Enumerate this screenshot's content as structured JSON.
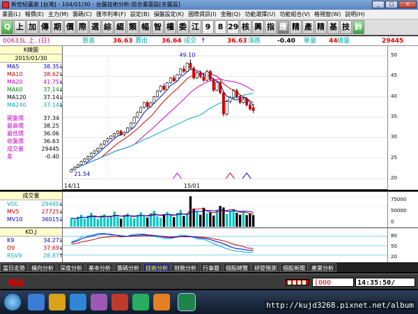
{
  "window": {
    "title": "新世紀贏家 [台灣] - 104/01/30 - 台盤技術分析:綜合畫面設[名盤設]",
    "buttons": [
      "_",
      "□",
      "X"
    ]
  },
  "menu": [
    "畫面(L)",
    "報價(E)",
    "主力(M)",
    "籌碼(C)",
    "匯市利率(F)",
    "設定(B)",
    "損盤設定(K)",
    "國際資訊(I)",
    "金融(Q)",
    "功能選擇(U)",
    "功能組合(V)",
    "格視窗(W)",
    "說明(H)"
  ],
  "toolbar": {
    "buttons": [
      "Q",
      "上",
      "加",
      "傳",
      "期",
      "價",
      "際",
      "選",
      "綜",
      "綴",
      "類",
      "幅",
      "智",
      "權",
      "委",
      "江",
      "9",
      "8",
      "29",
      "核",
      "興",
      "指",
      "應",
      "精",
      "產",
      "精",
      "基",
      "技",
      "鈴"
    ]
  },
  "quote": {
    "symbol": "00633L 上..(日)",
    "buy_label": "買進",
    "buy_value": "36.63",
    "sell_label": "賣出",
    "sell_value": "36.64",
    "deal_label": "成交",
    "deal_arrow": "↑",
    "deal_value": "36.63",
    "change_label": "漲跌",
    "change_value": "-0.40",
    "unit_label": "單量",
    "unit_value": "44",
    "total_label": "總量",
    "total_value": "29445"
  },
  "left_panel": {
    "title": "K線圖",
    "date": "2015/01/30",
    "ma": [
      {
        "label": "MA5",
        "value": "38.35",
        "arrow": "↓",
        "color": "#0000cc"
      },
      {
        "label": "MA10",
        "value": "38.62",
        "arrow": "↓",
        "color": "#cc0000"
      },
      {
        "label": "MA20",
        "value": "41.75",
        "arrow": "↓",
        "color": "#cc00cc"
      },
      {
        "label": "MA60",
        "value": "37.14",
        "arrow": "↓",
        "color": "#008800"
      },
      {
        "label": "MA120",
        "value": "37.14",
        "arrow": "↓",
        "color": "#000000"
      },
      {
        "label": "MA240",
        "value": "37.14",
        "arrow": "↓",
        "color": "#00aacc"
      }
    ],
    "prices": [
      {
        "label": "開盤價",
        "value": "37.34"
      },
      {
        "label": "最高價",
        "value": "38.25"
      },
      {
        "label": "最低價",
        "value": "36.06"
      },
      {
        "label": "收盤價",
        "value": "36.63"
      },
      {
        "label": "成交量",
        "value": "29445"
      },
      {
        "label": "差",
        "value": "-0.40"
      }
    ]
  },
  "volume_panel": {
    "title": "成交量",
    "rows": [
      {
        "label": "VOL",
        "value": "29445",
        "arrow": "↓",
        "color": "#00aacc"
      },
      {
        "label": "MV5",
        "value": "27725",
        "arrow": "↓",
        "color": "#cc0000"
      },
      {
        "label": "MV10",
        "value": "36015",
        "arrow": "↓",
        "color": "#0000cc"
      }
    ],
    "axis": [
      "75000",
      "50000",
      "0"
    ]
  },
  "kd_panel": {
    "title": "KD,J",
    "rows": [
      {
        "label": "K9",
        "value": "34.27",
        "arrow": "↓",
        "color": "#0000cc"
      },
      {
        "label": "D9",
        "value": "37.69",
        "arrow": "↓",
        "color": "#cc0000"
      },
      {
        "label": "RSV9",
        "value": "28.87",
        "arrow": "↑",
        "color": "#00aacc"
      }
    ],
    "axis": [
      "80",
      "50",
      "20"
    ]
  },
  "main_chart": {
    "high_label": "49.10",
    "low_label": "21.54",
    "x_labels": [
      "14/11",
      "15/01"
    ],
    "y_axis": [
      "50",
      "45",
      "40",
      "35",
      "30",
      "25",
      "20"
    ]
  },
  "tabs": [
    "當日走勢",
    "橫向分析",
    "深度分析",
    "基本分析",
    "籌碼分析",
    "技術分析",
    "財務分析",
    "行事曆",
    "個股總覽",
    "研發預測",
    "個股新聞",
    "產業分析"
  ],
  "active_tab": "技術分析",
  "status": {
    "brand": "精誠",
    "message": "[000",
    "clock": "14:35:50/"
  },
  "watermark": "http://kujd3268.pixnet.net/album",
  "chart_data": {
    "type": "candlestick",
    "title": "",
    "x_labels": [
      "14/11",
      "15/01"
    ],
    "ylim": [
      20,
      50
    ],
    "annotations": {
      "high": 49.1,
      "low": 21.54
    },
    "candles": [
      [
        21.6,
        22.4,
        21.5,
        22.2
      ],
      [
        22.2,
        23.0,
        22.0,
        22.8
      ],
      [
        22.8,
        23.6,
        22.6,
        23.4
      ],
      [
        23.4,
        24.4,
        23.2,
        24.2
      ],
      [
        24.2,
        25.0,
        23.9,
        24.8
      ],
      [
        24.8,
        25.6,
        24.5,
        25.4
      ],
      [
        25.4,
        26.4,
        25.2,
        26.2
      ],
      [
        26.2,
        27.0,
        25.9,
        26.8
      ],
      [
        26.8,
        27.6,
        26.4,
        27.4
      ],
      [
        27.4,
        28.6,
        27.2,
        28.4
      ],
      [
        28.4,
        29.4,
        28.1,
        29.2
      ],
      [
        29.2,
        30.0,
        28.8,
        29.8
      ],
      [
        29.8,
        30.6,
        29.5,
        30.4
      ],
      [
        30.4,
        31.2,
        30.0,
        31.0
      ],
      [
        31.0,
        31.8,
        30.7,
        31.6
      ],
      [
        31.6,
        31.9,
        30.5,
        30.8
      ],
      [
        30.8,
        31.5,
        30.3,
        31.3
      ],
      [
        31.3,
        32.6,
        31.1,
        32.4
      ],
      [
        32.4,
        33.8,
        32.2,
        33.6
      ],
      [
        33.6,
        35.2,
        33.4,
        35.0
      ],
      [
        35.0,
        36.4,
        34.8,
        36.2
      ],
      [
        36.2,
        37.6,
        36.0,
        37.4
      ],
      [
        37.4,
        38.8,
        37.1,
        38.6
      ],
      [
        38.6,
        39.0,
        37.2,
        37.6
      ],
      [
        37.6,
        38.8,
        37.3,
        38.5
      ],
      [
        38.5,
        40.2,
        38.3,
        40.0
      ],
      [
        40.0,
        41.6,
        39.8,
        41.4
      ],
      [
        41.4,
        42.8,
        41.1,
        42.6
      ],
      [
        42.6,
        43.2,
        41.4,
        41.8
      ],
      [
        41.8,
        43.6,
        41.6,
        43.4
      ],
      [
        43.4,
        44.8,
        43.2,
        44.6
      ],
      [
        44.6,
        45.2,
        43.6,
        43.9
      ],
      [
        43.9,
        45.6,
        43.7,
        45.4
      ],
      [
        45.4,
        47.0,
        45.2,
        46.8
      ],
      [
        46.8,
        47.6,
        45.8,
        46.2
      ],
      [
        46.2,
        48.4,
        46.0,
        48.2
      ],
      [
        48.2,
        49.1,
        46.6,
        47.0
      ],
      [
        47.0,
        47.4,
        44.2,
        44.6
      ],
      [
        44.6,
        46.2,
        44.3,
        45.9
      ],
      [
        45.9,
        46.4,
        44.5,
        44.9
      ],
      [
        44.9,
        45.8,
        43.6,
        44.0
      ],
      [
        44.0,
        46.6,
        43.8,
        46.2
      ],
      [
        46.2,
        46.6,
        43.9,
        44.2
      ],
      [
        44.2,
        44.6,
        41.2,
        41.6
      ],
      [
        41.6,
        43.8,
        41.4,
        43.5
      ],
      [
        43.5,
        43.9,
        40.6,
        41.0
      ],
      [
        41.0,
        41.4,
        35.2,
        35.8
      ],
      [
        35.8,
        39.2,
        35.4,
        38.8
      ],
      [
        38.8,
        40.2,
        38.4,
        39.8
      ],
      [
        39.8,
        41.8,
        39.5,
        41.5
      ],
      [
        41.5,
        42.0,
        39.6,
        40.0
      ],
      [
        40.0,
        40.4,
        38.2,
        38.6
      ],
      [
        38.6,
        39.8,
        38.3,
        39.4
      ],
      [
        39.4,
        39.9,
        37.6,
        38.0
      ],
      [
        38.0,
        38.4,
        36.6,
        37.0
      ],
      [
        37.34,
        38.25,
        36.06,
        36.63
      ]
    ],
    "volume": [
      22,
      18,
      25,
      30,
      20,
      28,
      35,
      24,
      19,
      26,
      31,
      22,
      27,
      38,
      25,
      20,
      29,
      33,
      24,
      21,
      30,
      36,
      28,
      23,
      34,
      40,
      26,
      22,
      31,
      37,
      29,
      24,
      35,
      42,
      27,
      33,
      76,
      45,
      38,
      30,
      47,
      34,
      36,
      28,
      41,
      52,
      48,
      32,
      39,
      44,
      35,
      30,
      37,
      29,
      33,
      29
    ],
    "kd": {
      "k": [
        60,
        66,
        72,
        78,
        83,
        86,
        88,
        87,
        85,
        82,
        80,
        82,
        84,
        86,
        85,
        83,
        80,
        78,
        76,
        78,
        80,
        81,
        79,
        76,
        74,
        70,
        66,
        60,
        52,
        46,
        40,
        38,
        36,
        34
      ],
      "d": [
        55,
        58,
        62,
        66,
        70,
        74,
        77,
        79,
        80,
        80,
        80,
        80,
        81,
        82,
        82,
        82,
        81,
        80,
        79,
        79,
        79,
        79,
        79,
        78,
        77,
        75,
        72,
        68,
        63,
        58,
        52,
        47,
        43,
        40
      ],
      "rsv": [
        62,
        70,
        78,
        82,
        86,
        90,
        90,
        84,
        80,
        78,
        80,
        86,
        88,
        88,
        82,
        80,
        76,
        74,
        72,
        80,
        84,
        82,
        76,
        72,
        70,
        62,
        56,
        48,
        40,
        36,
        32,
        30,
        28,
        29
      ]
    }
  }
}
